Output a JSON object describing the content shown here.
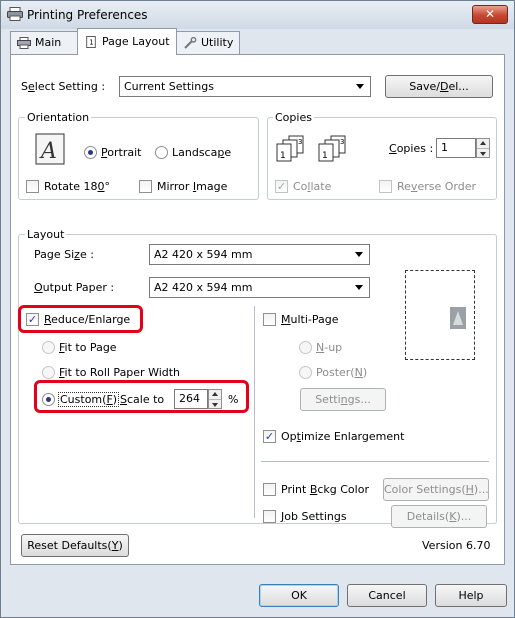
{
  "window": {
    "title": "Printing Preferences",
    "close": "✕"
  },
  "tabs": [
    {
      "label": "Main",
      "icon": "printer-icon"
    },
    {
      "label": "Page Layout",
      "icon": "page-layout-icon"
    },
    {
      "label": "Utility",
      "icon": "wrench-icon"
    }
  ],
  "select_setting": {
    "label_pre": "S",
    "label_u": "e",
    "label_post": "lect Setting :",
    "value": "Current Settings",
    "save_pre": "Save/",
    "save_u": "D",
    "save_post": "el..."
  },
  "orientation": {
    "title": "Orientation",
    "portrait_u": "P",
    "portrait_post": "ortrait",
    "landscape_pre": "Landsca",
    "landscape_u": "p",
    "landscape_post": "e",
    "rotate_pre": "Rotate 18",
    "rotate_u": "0",
    "rotate_post": "°",
    "mirror_pre": "Mirror ",
    "mirror_u": "I",
    "mirror_post": "mage"
  },
  "copies": {
    "title": "Copies",
    "copies_u": "C",
    "copies_post": "opies :",
    "copies_value": "1",
    "collate_pre": "Co",
    "collate_u": "l",
    "collate_post": "late",
    "reverse_pre": "Re",
    "reverse_u": "v",
    "reverse_post": "erse Order"
  },
  "layout": {
    "title": "Layout",
    "page_size_pre": "Page Si",
    "page_size_u": "z",
    "page_size_post": "e :",
    "page_size_value": "A2 420 x 594 mm",
    "output_pre": "",
    "output_u": "O",
    "output_post": "utput Paper :",
    "output_value": "A2 420 x 594 mm",
    "reduce_u": "R",
    "reduce_post": "educe/Enlarge",
    "fit_page_u": "F",
    "fit_page_post": "it to Page",
    "fit_roll_u": "F",
    "fit_roll_post": "it to Roll Paper Width",
    "custom_pre": "Custom(",
    "custom_u": "F",
    "custom_post": ")",
    "scale_u": "S",
    "scale_post": "cale to",
    "scale_value": "264",
    "scale_unit": "%",
    "multipage_u": "M",
    "multipage_post": "ulti-Page",
    "nup_u": "N",
    "nup_post": "-up",
    "poster_pre": "Poster(",
    "poster_u": "N",
    "poster_post": ")",
    "settings_pre": "Setti",
    "settings_u": "n",
    "settings_post": "gs..."
  },
  "options": {
    "optimize_pre": "Op",
    "optimize_u": "t",
    "optimize_post": "imize Enlargement",
    "print_bckg_pre": "Print ",
    "print_bckg_u": "B",
    "print_bckg_post": "ckg Color",
    "color_settings_pre": "Color Settings(",
    "color_settings_u": "H",
    "color_settings_post": ")...",
    "job_u": "J",
    "job_post": "ob Settings",
    "details_pre": "Details(",
    "details_u": "K",
    "details_post": ")..."
  },
  "footer": {
    "reset_pre": "Reset Defaults(",
    "reset_u": "Y",
    "reset_post": ")",
    "version": "Version 6.70",
    "ok": "OK",
    "cancel": "Cancel",
    "help": "Help"
  },
  "colors": {
    "highlight": "#e4001b",
    "window_bg": "#dfe6ee"
  }
}
